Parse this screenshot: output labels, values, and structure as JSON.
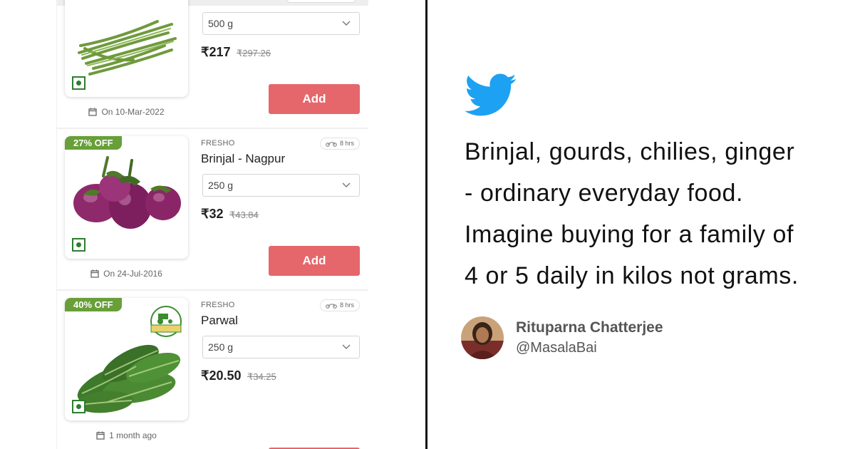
{
  "colors": {
    "offer_badge": "#689f38",
    "add_button": "#e5676b",
    "veg_mark": "#2e7d32",
    "twitter_blue": "#1da1f2"
  },
  "products": [
    {
      "offer": "",
      "brand": "",
      "name": "",
      "eta": "",
      "quantity": "500 g",
      "price": "₹217",
      "mrp": "₹297.26",
      "add_label": "Add",
      "date": "On 10-Mar-2022",
      "image_icon": "green-beans-icon"
    },
    {
      "offer": "27% OFF",
      "brand": "FRESHO",
      "name": "Brinjal - Nagpur",
      "eta": "8 hrs",
      "quantity": "250 g",
      "price": "₹32",
      "mrp": "₹43.84",
      "add_label": "Add",
      "date": "On 24-Jul-2016",
      "image_icon": "brinjal-icon"
    },
    {
      "offer": "40% OFF",
      "brand": "FRESHO",
      "name": "Parwal",
      "eta": "8 hrs",
      "quantity": "250 g",
      "price": "₹20.50",
      "mrp": "₹34.25",
      "add_label": "Add",
      "date": "1 month ago",
      "image_icon": "parwal-icon"
    }
  ],
  "tweet": {
    "lines": [
      "Brinjal, gourds, chilies, ginger",
      "- ordinary everyday food.",
      "Imagine buying for a family of",
      "4 or 5 daily in kilos not grams."
    ],
    "author_name": "Rituparna Chatterjee",
    "author_handle": "@MasalaBai"
  }
}
